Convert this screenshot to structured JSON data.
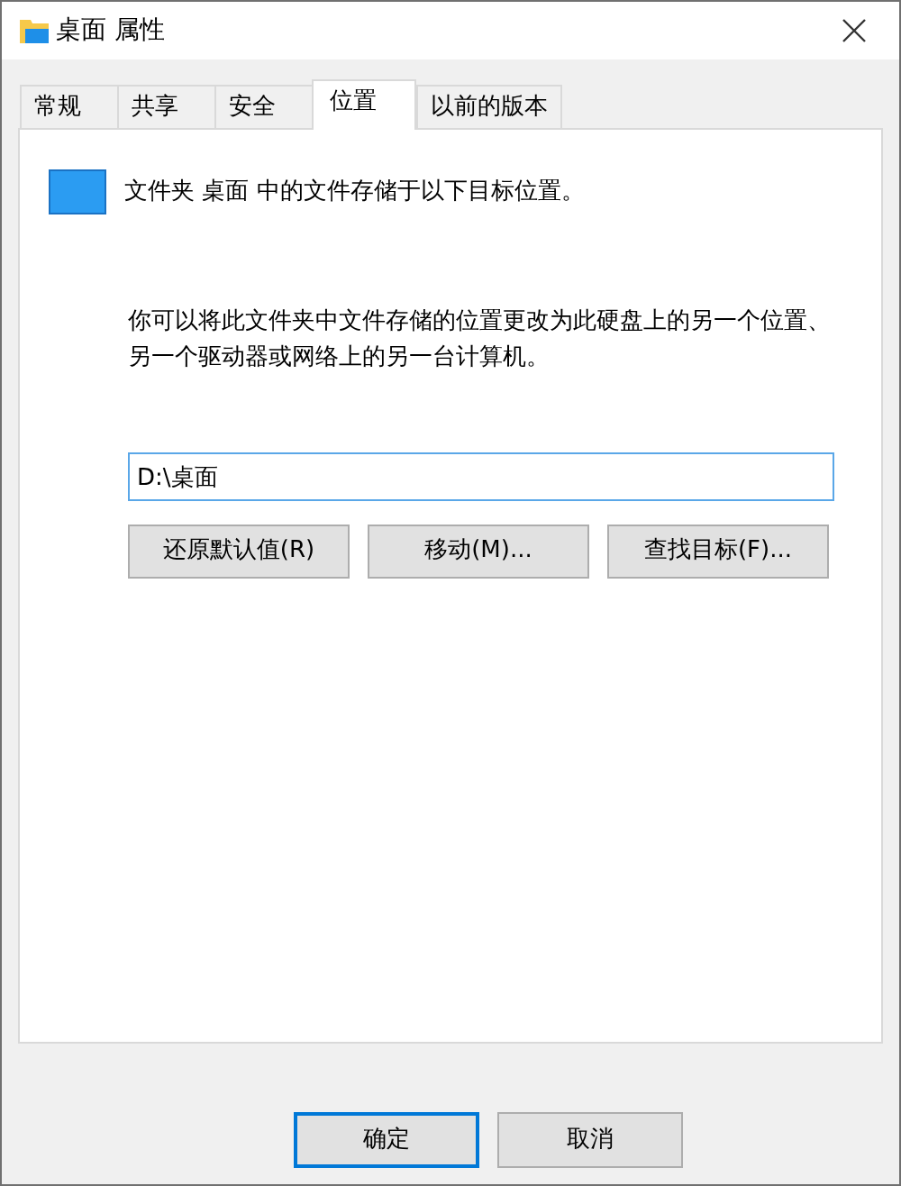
{
  "window": {
    "title": "桌面 属性"
  },
  "tabs": [
    {
      "label": "常规",
      "selected": false
    },
    {
      "label": "共享",
      "selected": false
    },
    {
      "label": "安全",
      "selected": false
    },
    {
      "label": "位置",
      "selected": true
    },
    {
      "label": "以前的版本",
      "selected": false
    }
  ],
  "header_text": "文件夹 桌面 中的文件存储于以下目标位置。",
  "description": "你可以将此文件夹中文件存储的位置更改为此硬盘上的另一个位置、另一个驱动器或网络上的另一台计算机。",
  "path_field": {
    "value": "D:\\桌面"
  },
  "location_buttons": [
    "还原默认值(R)",
    "移动(M)...",
    "查找目标(F)..."
  ],
  "dialog_buttons": [
    {
      "label": "确定",
      "default": true
    },
    {
      "label": "取消",
      "default": false
    }
  ]
}
